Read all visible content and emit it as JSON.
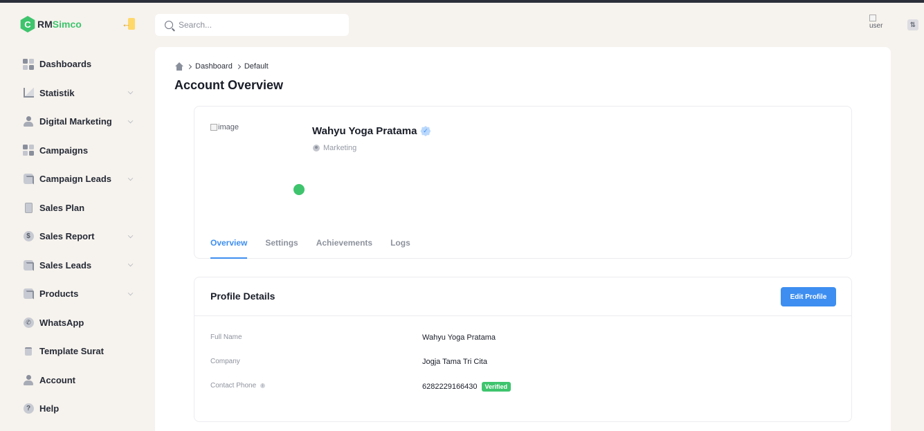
{
  "app": {
    "logo_letter": "C",
    "logo_text_dark": "RM",
    "logo_text_green": "Simco"
  },
  "sidebar": {
    "items": [
      {
        "label": "Dashboards",
        "icon": "dashboard-grid-icon",
        "has_submenu": false
      },
      {
        "label": "Statistik",
        "icon": "chart-icon",
        "has_submenu": true
      },
      {
        "label": "Digital Marketing",
        "icon": "user-icon",
        "has_submenu": true
      },
      {
        "label": "Campaigns",
        "icon": "dashboard-grid-icon",
        "has_submenu": false
      },
      {
        "label": "Campaign Leads",
        "icon": "document-icon",
        "has_submenu": true
      },
      {
        "label": "Sales Plan",
        "icon": "page-icon",
        "has_submenu": false
      },
      {
        "label": "Sales Report",
        "icon": "dollar-icon",
        "has_submenu": true
      },
      {
        "label": "Sales Leads",
        "icon": "document-icon",
        "has_submenu": true
      },
      {
        "label": "Products",
        "icon": "document-icon",
        "has_submenu": true
      },
      {
        "label": "WhatsApp",
        "icon": "phone-icon",
        "has_submenu": false
      },
      {
        "label": "Template Surat",
        "icon": "letter-icon",
        "has_submenu": false
      },
      {
        "label": "Account",
        "icon": "user-icon",
        "has_submenu": false
      },
      {
        "label": "Help",
        "icon": "help-icon",
        "has_submenu": false
      }
    ]
  },
  "header": {
    "search_placeholder": "Search...",
    "user_image_alt": "user"
  },
  "breadcrumb": {
    "items": [
      "Dashboard",
      "Default"
    ]
  },
  "page": {
    "title": "Account Overview"
  },
  "profile": {
    "image_alt": "image",
    "name": "Wahyu Yoga Pratama",
    "role": "Marketing",
    "status_color": "#3ec46d",
    "tabs": [
      {
        "label": "Overview",
        "active": true
      },
      {
        "label": "Settings",
        "active": false
      },
      {
        "label": "Achievements",
        "active": false
      },
      {
        "label": "Logs",
        "active": false
      }
    ]
  },
  "details": {
    "title": "Profile Details",
    "edit_label": "Edit Profile",
    "rows": [
      {
        "label": "Full Name",
        "value": "Wahyu Yoga Pratama"
      },
      {
        "label": "Company",
        "value": "Jogja Tama Tri Cita"
      },
      {
        "label": "Contact Phone",
        "value": "6282229166430",
        "badge": "Verified"
      }
    ]
  },
  "colors": {
    "accent": "#3d8ef0",
    "brand_green": "#3ec46d",
    "background": "#f6f2ed"
  }
}
